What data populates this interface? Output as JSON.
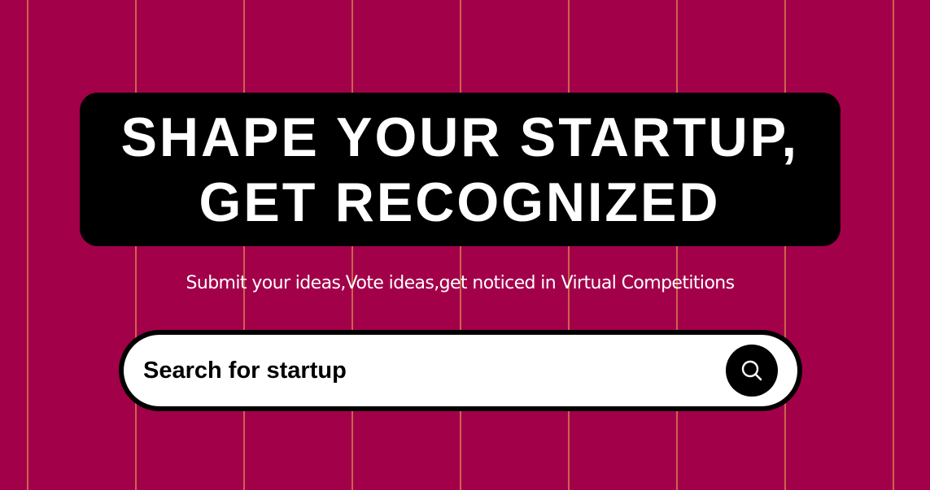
{
  "hero": {
    "title_line1": "SHAPE YOUR STARTUP,",
    "title_line2": "GET RECOGNIZED",
    "subtitle": "Submit your ideas,Vote ideas,get noticed in Virtual Competitions"
  },
  "search": {
    "placeholder": "Search for startup",
    "value": "",
    "button_icon": "search-icon"
  },
  "colors": {
    "background": "#a3004a",
    "stripe": "#d8864a",
    "hero_box": "#000000",
    "text_light": "#ffffff",
    "search_bg": "#ffffff",
    "search_border": "#000000"
  }
}
